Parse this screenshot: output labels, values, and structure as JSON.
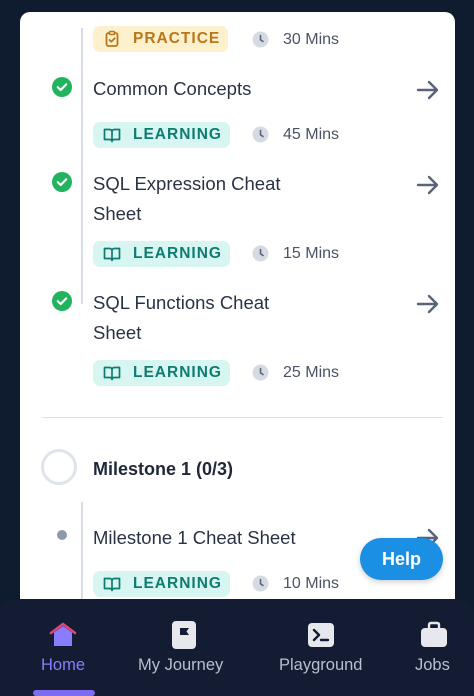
{
  "items": [
    {
      "title": "",
      "badge_label": "PRACTICE",
      "badge_type": "practice",
      "duration": "30 Mins"
    },
    {
      "title": "Common Concepts",
      "badge_label": "LEARNING",
      "badge_type": "learning",
      "duration": "45 Mins"
    },
    {
      "title": "SQL Expression Cheat Sheet",
      "badge_label": "LEARNING",
      "badge_type": "learning",
      "duration": "15 Mins"
    },
    {
      "title": "SQL Functions Cheat Sheet",
      "badge_label": "LEARNING",
      "badge_type": "learning",
      "duration": "25 Mins"
    }
  ],
  "milestone": {
    "title": "Milestone 1 (0/3)",
    "item": {
      "title": "Milestone 1 Cheat Sheet",
      "badge_label": "LEARNING",
      "duration": "10 Mins"
    }
  },
  "help_button": "Help",
  "nav": [
    {
      "label": "Home",
      "icon": "home-icon",
      "active": true
    },
    {
      "label": "My Journey",
      "icon": "flag-icon",
      "active": false
    },
    {
      "label": "Playground",
      "icon": "terminal-icon",
      "active": false
    },
    {
      "label": "Jobs",
      "icon": "briefcase-icon",
      "active": false
    }
  ],
  "colors": {
    "check_green": "#22b35e",
    "learning_bg": "#d7f5f1",
    "learning_text": "#0f7c72",
    "practice_bg": "#fdf0cc",
    "practice_text": "#b9761a",
    "help_blue": "#1a8fe3",
    "nav_bg": "#131c33",
    "nav_active": "#8a7cff"
  }
}
